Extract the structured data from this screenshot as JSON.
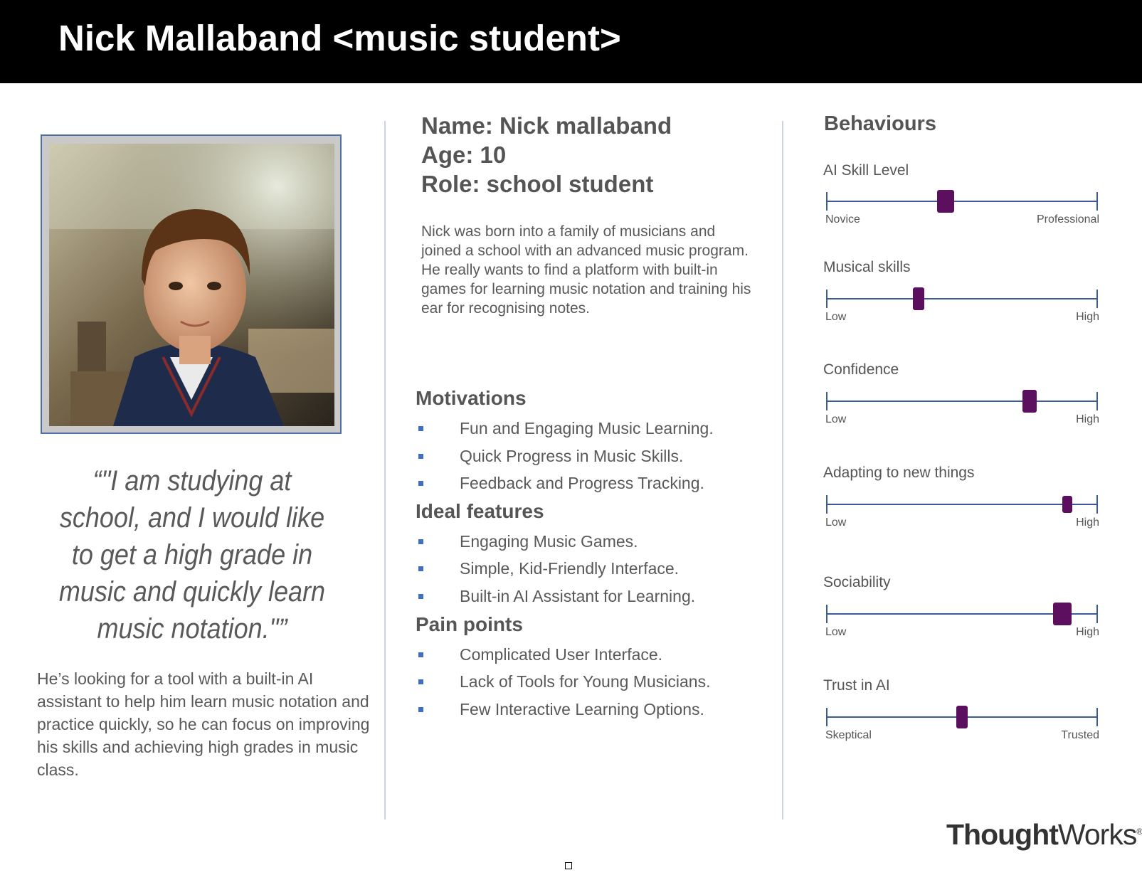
{
  "header": {
    "title": "Nick Mallaband <music student>"
  },
  "profile": {
    "photo_icon": "boy-portrait",
    "quote": "“\"I am studying at school, and I would like to get a high grade in music and quickly learn music notation.\"”",
    "summary": "He’s looking for a tool with a built-in AI assistant to help him learn music notation and practice quickly, so he can focus on improving his skills and achieving high grades in music class."
  },
  "info": {
    "name": "Name: Nick mallaband",
    "age": "Age: 10",
    "role": "Role: school student",
    "bio": "Nick was born into a family of musicians and joined a school with an advanced music program. He really wants to find a platform with built-in games for learning music notation and training his ear for recognising notes."
  },
  "sections": [
    {
      "title": "Motivations",
      "items": [
        "Fun and Engaging Music Learning.",
        "Quick Progress in Music Skills.",
        "Feedback and Progress Tracking."
      ]
    },
    {
      "title": "Ideal features",
      "items": [
        "Engaging Music Games.",
        "Simple, Kid-Friendly Interface.",
        "Built-in AI Assistant for Learning."
      ]
    },
    {
      "title": "Pain points",
      "items": [
        "Complicated User Interface.",
        "Lack of Tools for Young Musicians.",
        "Few Interactive Learning Options."
      ]
    }
  ],
  "behaviours": {
    "title": "Behaviours",
    "sliders": [
      {
        "label": "AI Skill Level",
        "min": "Novice",
        "max": "Professional",
        "value": 0.44
      },
      {
        "label": "Musical skills",
        "min": "Low",
        "max": "High",
        "value": 0.34
      },
      {
        "label": "Confidence",
        "min": "Low",
        "max": "High",
        "value": 0.75
      },
      {
        "label": "Adapting to new things",
        "min": "Low",
        "max": "High",
        "value": 0.89
      },
      {
        "label": "Sociability",
        "min": "Low",
        "max": "High",
        "value": 0.87
      },
      {
        "label": "Trust in AI",
        "min": "Skeptical",
        "max": "Trusted",
        "value": 0.5
      }
    ]
  },
  "brand": {
    "logo_bold": "Thought",
    "logo_regular": "Works",
    "logo_mark": "®"
  },
  "colors": {
    "header_bg": "#000000",
    "accent_purple": "#5b0f5e",
    "track_blue": "#3b5b9c",
    "bullet_blue": "#3f6fbf"
  }
}
